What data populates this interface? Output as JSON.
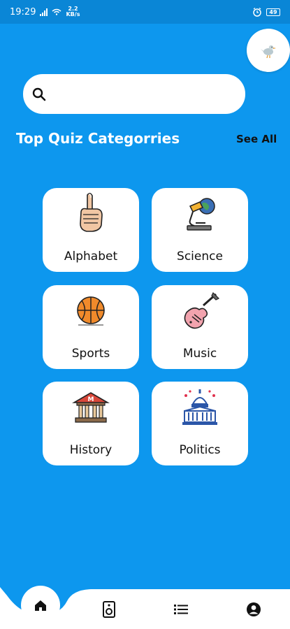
{
  "status_bar": {
    "time": "19:29",
    "data_rate_top": "2.2",
    "data_rate_unit": "KB/s",
    "battery": "49"
  },
  "search": {
    "placeholder": ""
  },
  "section": {
    "title": "Top Quiz Categorries",
    "see_all": "See All"
  },
  "categories": [
    {
      "label": "Alphabet",
      "icon": "sign-language-hand-icon"
    },
    {
      "label": "Science",
      "icon": "microscope-globe-icon"
    },
    {
      "label": "Sports",
      "icon": "basketball-icon"
    },
    {
      "label": "Music",
      "icon": "electric-guitar-icon"
    },
    {
      "label": "History",
      "icon": "museum-building-icon"
    },
    {
      "label": "Politics",
      "icon": "capitol-building-icon"
    }
  ],
  "nav": {
    "items": [
      "home-icon",
      "speaker-icon",
      "list-icon",
      "profile-icon"
    ],
    "active": "home-icon"
  },
  "colors": {
    "background": "#0d97ee",
    "status_bar": "#0a86d6",
    "card": "#ffffff",
    "text_dark": "#111111"
  }
}
